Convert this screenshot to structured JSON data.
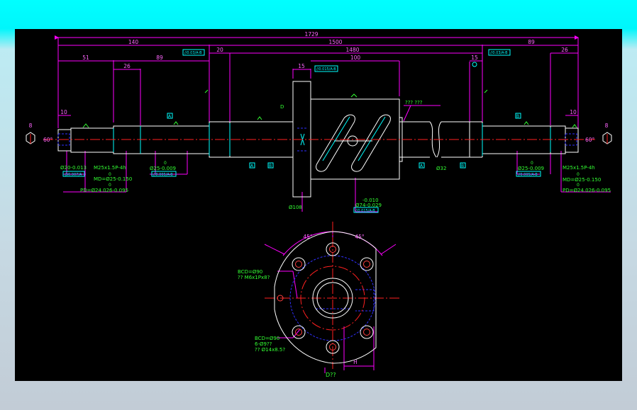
{
  "colors": {
    "bg_top": "#00ffff",
    "bg_bottom": "#c2ccd6",
    "canvas": "#000000",
    "outline": "#ffffff",
    "dimension": "#ff00ff",
    "centerline": "#ff0000",
    "annotation": "#00ff00",
    "hidden": "#0000ff",
    "datum": "#00ffff",
    "bolt": "#ff4040"
  },
  "dims": {
    "total": "1729",
    "left_block": "140",
    "screw": "1500",
    "right_block": "89",
    "left_51": "51",
    "left_89": "89",
    "left_26": "26",
    "left_20": "20",
    "thread_1480": "1480",
    "nut_15": "15",
    "nut_100": "100",
    "right_15": "15",
    "right_26": "26",
    "left_10": "10",
    "right_10": "10",
    "left_8": "8",
    "right_8": "8",
    "left_60": "60°",
    "right_60": "60°",
    "angle_left": "45°",
    "angle_right": "45°",
    "right_h": "H"
  },
  "datums": {
    "top_left": "//0.03/A-B",
    "top_right": "//0.03/A-B",
    "nut": "//0.015/A-B",
    "a_left": "A",
    "b_right": "B",
    "sq1": "A",
    "sq2": "B",
    "sq3": "A",
    "sq4": "B",
    "left_shaft": "@0.007/A",
    "left_bearing": "//0.005/A-B",
    "nut_tol": "//0.015/A-B",
    "right_bearing": "//0.005/A-B"
  },
  "labels": {
    "left_dia": "Ø20-0.013",
    "left_thread": "M25x1.5P-4h",
    "left_md": "MD=Ø25-0.150",
    "left_md_zero": "0",
    "left_pd": "PD=Ø24.026-0.095",
    "left_pd_zero": "0",
    "left_bearing": "Ø25-0.009",
    "left_bearing_zero": "0",
    "d_mark": "D",
    "flange_dia": "Ø108",
    "nut_dia_tol": "-0.010",
    "nut_dia": "Ø74-0.029",
    "right_top_note": "??? ???",
    "screw_dia": "Ø32",
    "right_bearing": "Ø25-0.009",
    "right_bearing_zero": "0",
    "right_thread": "M25x1.5P-4h",
    "right_md": "MD=Ø25-0.150",
    "right_md_zero": "0",
    "right_pd": "PD=Ø24.026-0.095",
    "right_pd_zero": "0",
    "bcd_top": "BCD=Ø90",
    "bcd_top_note": "?? M6x1Px8?",
    "bcd_bottom": "BCD=Ø90",
    "bcd_bottom_note1": "6-Ø9??",
    "bcd_bottom_note2": "?? Ø14x8.5?",
    "view_label": "D??"
  }
}
